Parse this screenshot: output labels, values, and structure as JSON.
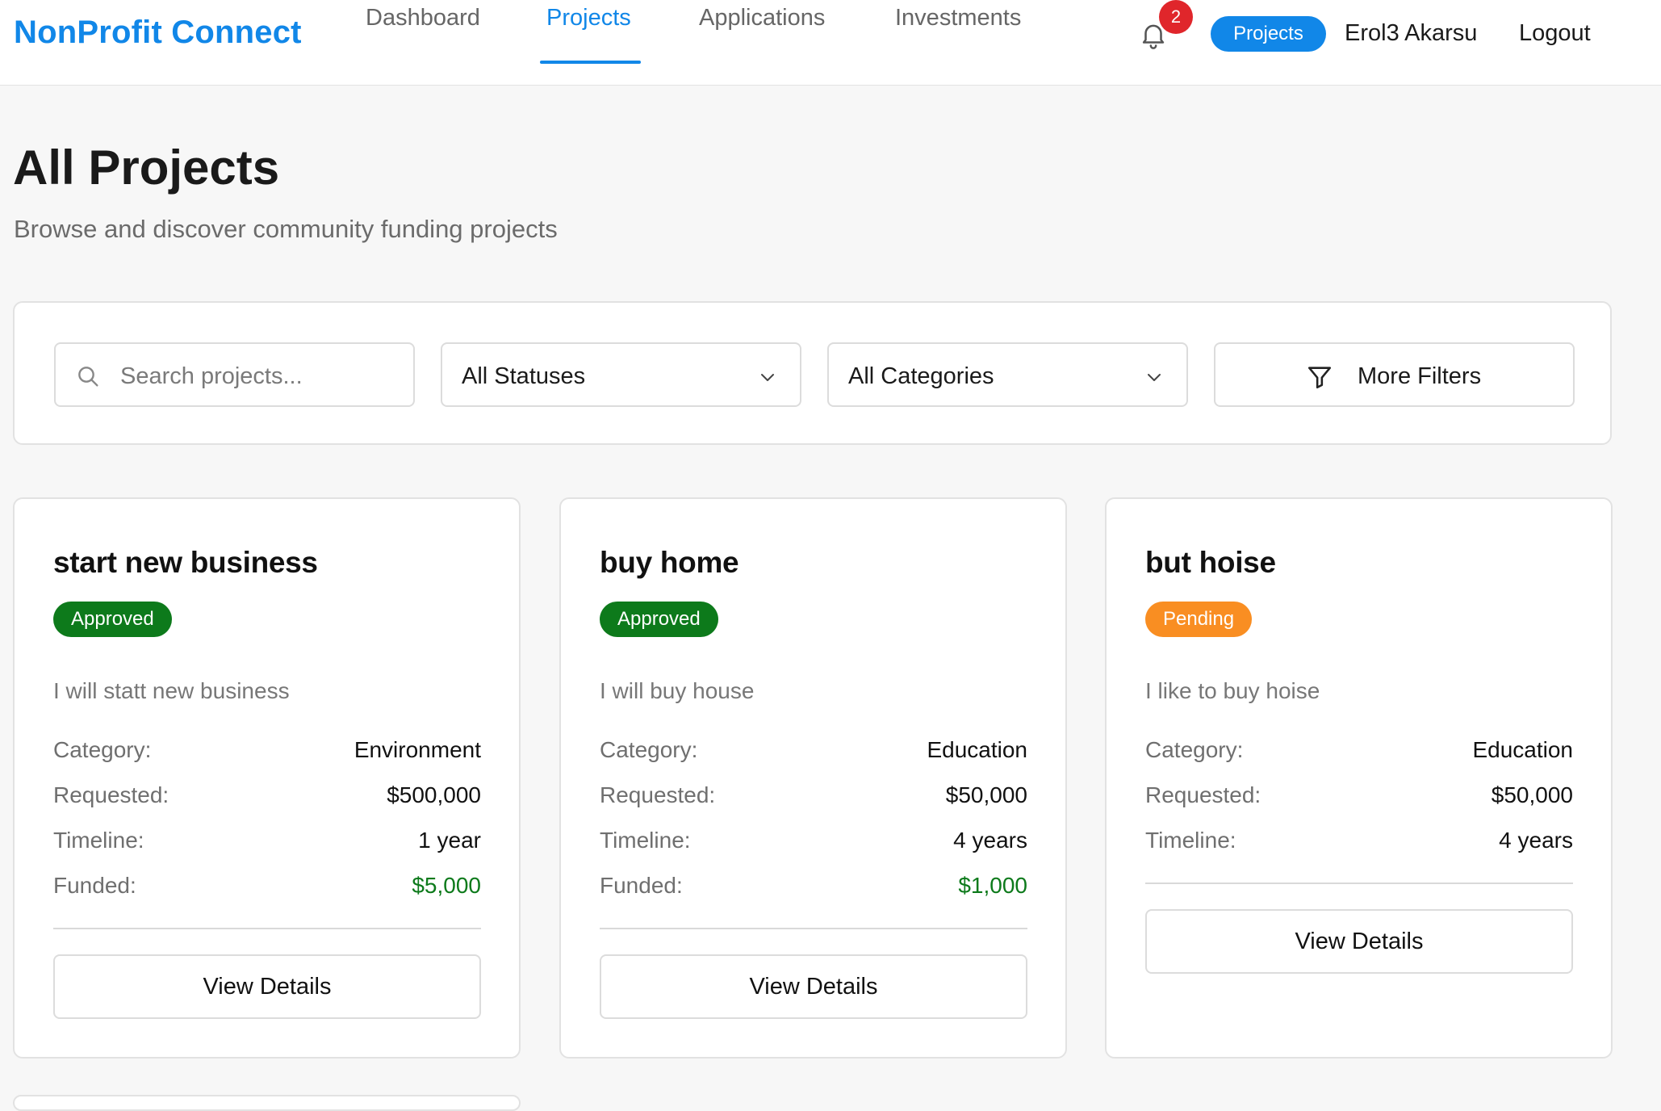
{
  "header": {
    "brand": "NonProfit Connect",
    "nav": [
      {
        "label": "Dashboard"
      },
      {
        "label": "Projects",
        "active": true
      },
      {
        "label": "Applications"
      },
      {
        "label": "Investments"
      }
    ],
    "notification_count": "2",
    "projects_pill": "Projects",
    "user_name": "Erol3 Akarsu",
    "logout_label": "Logout"
  },
  "page": {
    "title": "All Projects",
    "subtitle": "Browse and discover community funding projects"
  },
  "filters": {
    "search_placeholder": "Search projects...",
    "status_selected": "All Statuses",
    "category_selected": "All Categories",
    "more_filters_label": "More Filters"
  },
  "labels": {
    "category": "Category:",
    "requested": "Requested:",
    "timeline": "Timeline:",
    "funded": "Funded:",
    "view_details": "View Details"
  },
  "projects": [
    {
      "title": "start new business",
      "status": "Approved",
      "description": "I will statt new business",
      "category": "Environment",
      "requested": "$500,000",
      "timeline": "1 year",
      "funded": "$5,000"
    },
    {
      "title": "buy home",
      "status": "Approved",
      "description": "I will buy house",
      "category": "Education",
      "requested": "$50,000",
      "timeline": "4 years",
      "funded": "$1,000"
    },
    {
      "title": "but hoise",
      "status": "Pending",
      "description": "I like to buy hoise",
      "category": "Education",
      "requested": "$50,000",
      "timeline": "4 years"
    }
  ],
  "colors": {
    "accent": "#1187e8",
    "approved": "#0d7a1b",
    "pending": "#f98e22",
    "notification": "#e0262b"
  },
  "icons": {
    "bell": "bell-icon",
    "search": "search-icon",
    "chevron": "chevron-down-icon",
    "filter": "filter-funnel-icon"
  }
}
